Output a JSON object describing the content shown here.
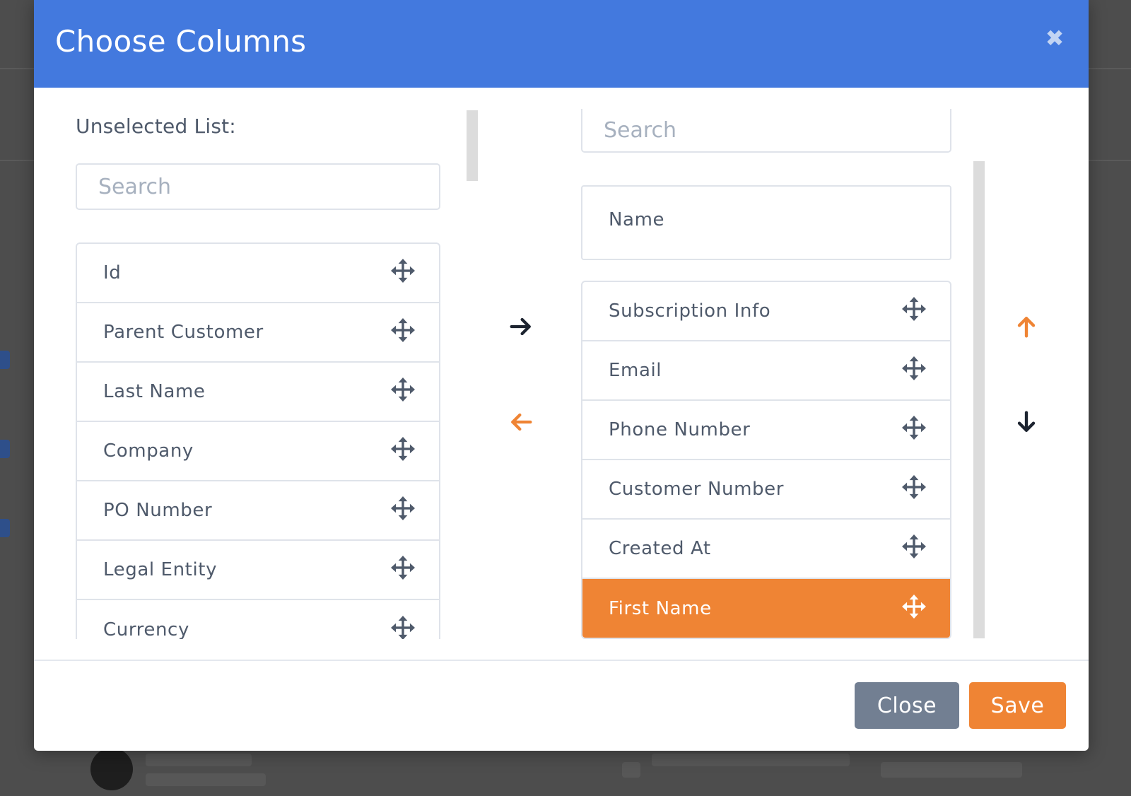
{
  "modal": {
    "title": "Choose Columns",
    "close_icon": "close-icon"
  },
  "unselected": {
    "label": "Unselected List:",
    "search_placeholder": "Search",
    "items": [
      "Id",
      "Parent Customer",
      "Last Name",
      "Company",
      "PO Number",
      "Legal Entity",
      "Currency"
    ]
  },
  "selected": {
    "search_placeholder": "Search",
    "pinned": "Name",
    "items": [
      "Subscription Info",
      "Email",
      "Phone Number",
      "Customer Number",
      "Created At",
      "First Name"
    ],
    "highlighted": "First Name"
  },
  "footer": {
    "close_label": "Close",
    "save_label": "Save"
  },
  "colors": {
    "header": "#4379de",
    "accent": "#ef8434",
    "muted_button": "#727f92",
    "dark_arrow": "#1d2430"
  },
  "icons": {
    "move": "move-icon",
    "arrow_right": "arrow-right-icon",
    "arrow_left": "arrow-left-icon",
    "arrow_up": "arrow-up-icon",
    "arrow_down": "arrow-down-icon"
  }
}
